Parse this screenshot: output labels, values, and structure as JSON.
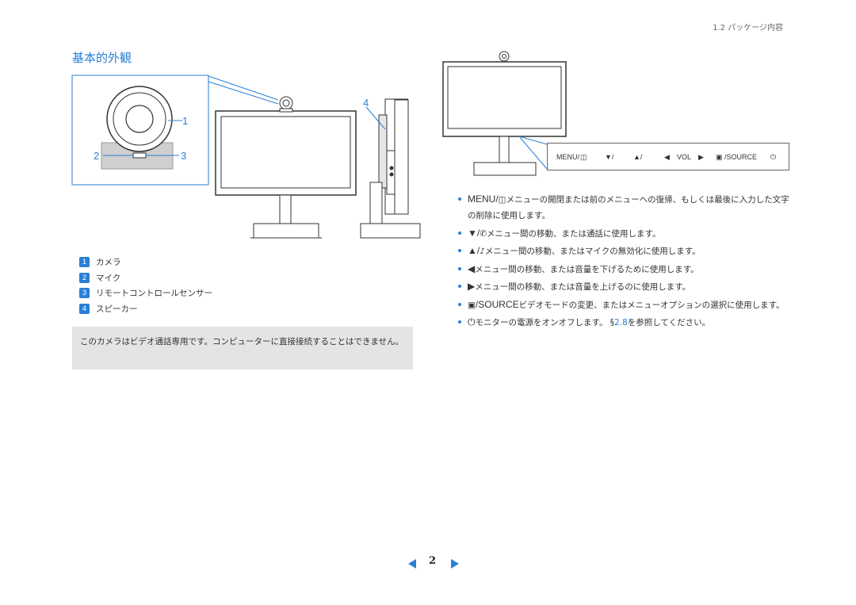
{
  "header": {
    "section": "1.2 パッケージ内容"
  },
  "title": "基本的外観",
  "callouts": {
    "c1": "1",
    "c2": "2",
    "c3": "3",
    "c4": "4"
  },
  "legend": [
    {
      "num": "1",
      "label": "カメラ"
    },
    {
      "num": "2",
      "label": "マイク"
    },
    {
      "num": "3",
      "label": "リモートコントロールセンサー"
    },
    {
      "num": "4",
      "label": "スピーカー"
    }
  ],
  "note": "このカメラはビデオ通話専用です。コンピューターに直接接続することはできません。",
  "panel": {
    "menu": "MENU/",
    "down_mic": "▼/",
    "up_mic": "▲/",
    "vol_left": "◀",
    "vol": "VOL",
    "vol_right": "▶",
    "source": "/SOURCE",
    "power": "⏻"
  },
  "bullets": [
    {
      "sym": "MENU/",
      "text": "メニューの開閉または前のメニューへの復帰、もしくは最後に入力した文字の削除に使用します。"
    },
    {
      "sym": "▼/",
      "text": "メニュー間の移動、または通話に使用します。"
    },
    {
      "sym": "▲/",
      "text": "メニュー間の移動、またはマイクの無効化に使用します。"
    },
    {
      "sym": "◀",
      "text": "メニュー間の移動、または音量を下げるために使用します。"
    },
    {
      "sym": "▶",
      "text": "メニュー間の移動、または音量を上げるのに使用します。"
    },
    {
      "sym": "/SOURCE",
      "text": "ビデオモードの変更、またはメニューオプションの選択に使用します。"
    },
    {
      "sym": "⏻",
      "text_before": "モニターの電源をオンオフします。 §",
      "link": "2.8",
      "text_after": "を参照してください。"
    }
  ],
  "pager": {
    "page": "2"
  }
}
